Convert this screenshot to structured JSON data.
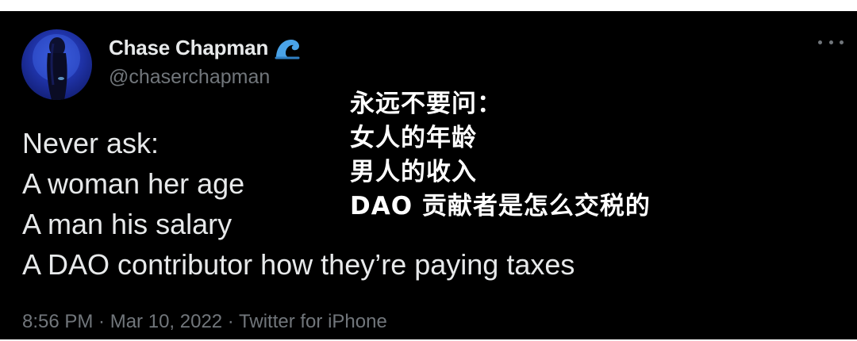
{
  "author": {
    "name": "Chase Chapman",
    "handle": "@chaserchapman",
    "avatar_icon": "profile-photo-avatar",
    "name_emoji_icon": "water-wave-icon"
  },
  "more_menu_icon": "more-horizontal-icon",
  "tweet": {
    "lines": [
      "Never ask:",
      "A woman her age",
      "A man his salary",
      "A DAO contributor how they’re paying taxes"
    ]
  },
  "caption": {
    "lines": [
      "永远不要问：",
      "女人的年龄",
      "男人的收入",
      "DAO 贡献者是怎么交税的"
    ]
  },
  "meta": {
    "time": "8:56 PM",
    "separator_1": " · ",
    "date": "Mar 10, 2022",
    "separator_2": " · ",
    "source": "Twitter for iPhone"
  },
  "colors": {
    "background": "#000000",
    "primary_text": "#e7e9ea",
    "secondary_text": "#71767b",
    "wave_icon": "#4aa3e8"
  }
}
